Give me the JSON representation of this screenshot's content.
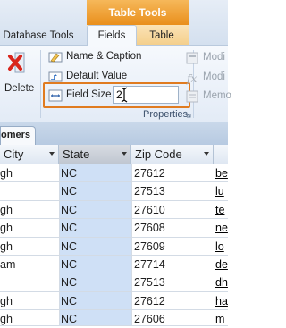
{
  "ribbon": {
    "context_header": "Table Tools",
    "tabs": {
      "database_tools": "Database Tools",
      "fields": "Fields",
      "table": "Table"
    },
    "delete_label": "Delete",
    "name_caption_label": "Name & Caption",
    "default_value_label": "Default Value",
    "field_size_label": "Field Size",
    "field_size_value": "2",
    "properties_group_label": "Properties",
    "greyed": {
      "modify1": "Modi",
      "modify2": "Modi",
      "memo": "Memo"
    }
  },
  "document_tab": "omers",
  "table": {
    "headers": {
      "city": "City",
      "state": "State",
      "zip": "Zip Code"
    },
    "rows": [
      {
        "city": "gh",
        "state": "NC",
        "zip": "27612",
        "extra": "be"
      },
      {
        "city": "",
        "state": "NC",
        "zip": "27513",
        "extra": "lu"
      },
      {
        "city": "gh",
        "state": "NC",
        "zip": "27610",
        "extra": "te"
      },
      {
        "city": "gh",
        "state": "NC",
        "zip": "27608",
        "extra": "ne"
      },
      {
        "city": "gh",
        "state": "NC",
        "zip": "27609",
        "extra": "lo"
      },
      {
        "city": "am",
        "state": "NC",
        "zip": "27714",
        "extra": "de"
      },
      {
        "city": "",
        "state": "NC",
        "zip": "27513",
        "extra": "dh"
      },
      {
        "city": "gh",
        "state": "NC",
        "zip": "27612",
        "extra": "ha"
      },
      {
        "city": "gh",
        "state": "NC",
        "zip": "27606",
        "extra": "m"
      }
    ]
  },
  "colors": {
    "accent_orange": "#e07b20",
    "context_tab_orange": "#f0a33a",
    "selected_column": "#cfe0f6"
  },
  "icons": {
    "delete": "delete-x-icon",
    "name_caption": "name-caption-icon",
    "default_value": "default-value-icon",
    "field_size": "field-size-icon",
    "modify": "modify-icon",
    "memo": "memo-icon"
  }
}
